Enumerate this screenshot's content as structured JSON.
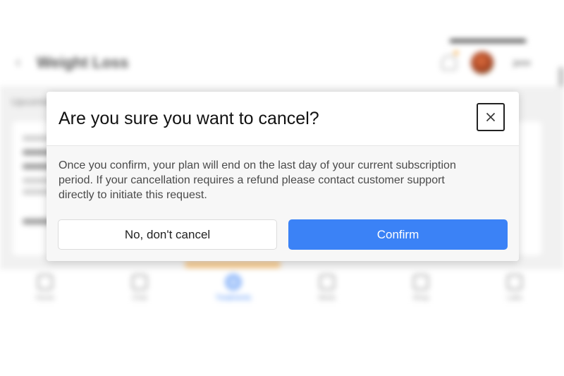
{
  "background": {
    "page_title": "Weight Loss",
    "user_name": "jenn",
    "section_heading": "Upcoming",
    "nav_items": [
      {
        "label": "Home",
        "icon": "home-icon",
        "active": false
      },
      {
        "label": "Chat",
        "icon": "chat-icon",
        "active": false
      },
      {
        "label": "Treatments",
        "icon": "treatments-icon",
        "active": true
      },
      {
        "label": "Meds",
        "icon": "pill-icon",
        "active": false
      },
      {
        "label": "Shop",
        "icon": "shop-icon",
        "active": false
      },
      {
        "label": "Labs",
        "icon": "labs-icon",
        "active": false
      }
    ]
  },
  "modal": {
    "title": "Are you sure you want to cancel?",
    "close_icon": "close-icon",
    "message": "Once you confirm, your plan will end on the last day of your current subscription period. If your cancellation requires a refund please contact customer support directly to initiate this request.",
    "cancel_label": "No, don't cancel",
    "confirm_label": "Confirm"
  },
  "colors": {
    "primary": "#3b82f6",
    "title_text": "#111111",
    "body_text": "#4a4a4a",
    "body_background": "#f7f7f7"
  }
}
